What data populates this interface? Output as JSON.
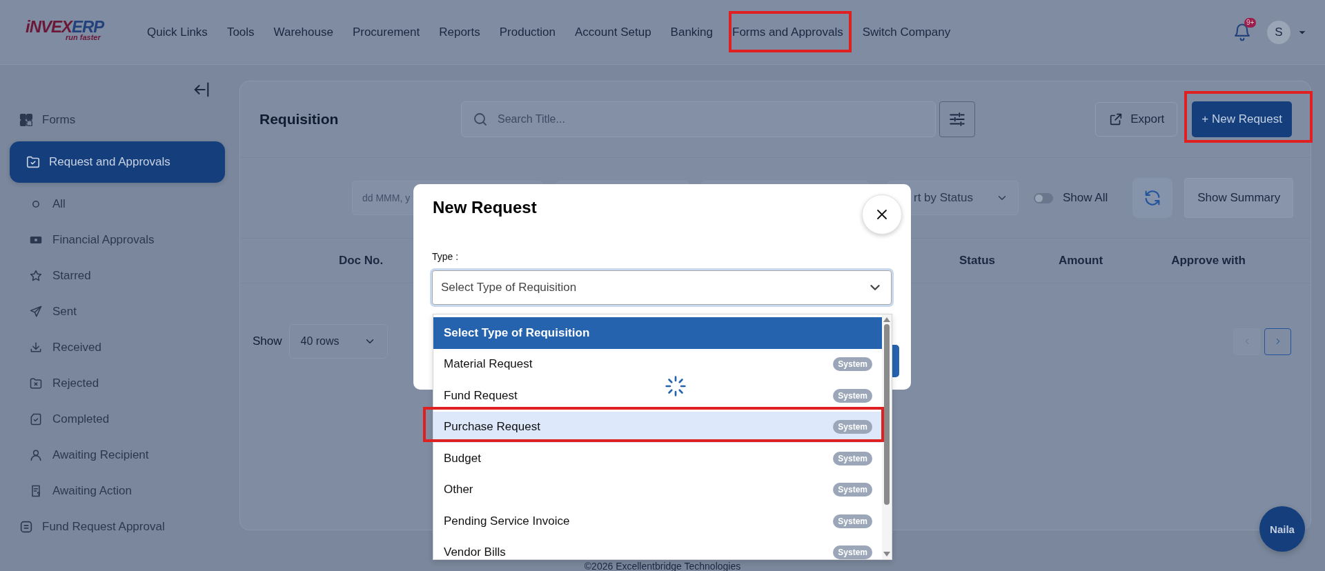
{
  "nav": {
    "logo": {
      "brand_part_1": "iNVEX",
      "brand_part_2": "ERP",
      "tagline": "run faster"
    },
    "items": [
      {
        "label": "Quick Links",
        "highlighted": false
      },
      {
        "label": "Tools",
        "highlighted": false
      },
      {
        "label": "Warehouse",
        "highlighted": false
      },
      {
        "label": "Procurement",
        "highlighted": false
      },
      {
        "label": "Reports",
        "highlighted": false
      },
      {
        "label": "Production",
        "highlighted": false
      },
      {
        "label": "Account Setup",
        "highlighted": false
      },
      {
        "label": "Banking",
        "highlighted": false
      },
      {
        "label": "Forms and Approvals",
        "highlighted": true
      },
      {
        "label": "Switch Company",
        "highlighted": false
      }
    ],
    "notification_badge": "9+",
    "avatar": "S"
  },
  "sidebar": {
    "items": [
      {
        "label": "Forms",
        "selected": false
      },
      {
        "label": "Request and Approvals",
        "selected": true,
        "children": [
          {
            "label": "All",
            "selected": false
          },
          {
            "label": "Financial Approvals",
            "selected": false
          },
          {
            "label": "Starred",
            "selected": false
          },
          {
            "label": "Sent",
            "selected": false
          },
          {
            "label": "Received",
            "selected": false
          },
          {
            "label": "Rejected",
            "selected": false
          },
          {
            "label": "Completed",
            "selected": false
          },
          {
            "label": "Awaiting Recipient",
            "selected": false
          },
          {
            "label": "Awaiting Action",
            "selected": false
          }
        ]
      },
      {
        "label": "Fund Request Approval",
        "selected": false
      }
    ]
  },
  "main": {
    "title": "Requisition",
    "search": {
      "placeholder": "Search Title..."
    },
    "export_button": "Export",
    "new_request_button": {
      "label": "+ New Request",
      "highlighted": true
    },
    "filters": {
      "date_placeholder": "dd MMM, y",
      "sort_value": "rt by Status",
      "show_all": {
        "label": "Show All",
        "on": false
      },
      "summary_button": "Show Summary"
    },
    "table": {
      "columns": [
        "Doc No.",
        "Status",
        "Amount",
        "Approve with"
      ]
    },
    "rows_select": {
      "label": "Show",
      "value": "40 rows"
    }
  },
  "footer": "©2026 Excellentbridge Technologies",
  "modal": {
    "title": "New Request",
    "type_label": "Type :",
    "type_select": {
      "value": "Select Type of Requisition",
      "expanded": true
    },
    "loading": true,
    "options": [
      {
        "label": "Select Type of Requisition",
        "selected": true,
        "hovered": false,
        "highlighted": false
      },
      {
        "label": "Material Request",
        "badge": "System",
        "selected": false,
        "hovered": false,
        "highlighted": false
      },
      {
        "label": "Fund Request",
        "badge": "System",
        "selected": false,
        "hovered": false,
        "highlighted": false
      },
      {
        "label": "Purchase Request",
        "badge": "System",
        "selected": false,
        "hovered": true,
        "highlighted": true
      },
      {
        "label": "Budget",
        "badge": "System",
        "selected": false,
        "hovered": false,
        "highlighted": false
      },
      {
        "label": "Other",
        "badge": "System",
        "selected": false,
        "hovered": false,
        "highlighted": false
      },
      {
        "label": "Pending Service Invoice",
        "badge": "System",
        "selected": false,
        "hovered": false,
        "highlighted": false
      },
      {
        "label": "Vendor Bills",
        "badge": "System",
        "selected": false,
        "hovered": false,
        "highlighted": false
      }
    ]
  },
  "chat_button": "Naila"
}
